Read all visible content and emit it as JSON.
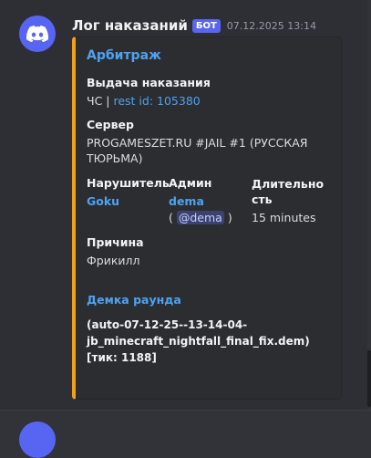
{
  "message": {
    "username": "Лог наказаний",
    "bot_tag": "БОТ",
    "timestamp": "07.12.2025 13:14",
    "avatar_icon": "discord-logo-icon"
  },
  "embed": {
    "accent_color": "#f0a020",
    "title": "Арбитраж",
    "issue_label": "Выдача наказания",
    "issue_prefix": "ЧС | ",
    "issue_link": "rest id: 105380",
    "server_label": "Сервер",
    "server_value": "PROGAMESZET.RU #JAIL #1 (РУССКАЯ ТЮРЬМА)",
    "violator_label": "Нарушитель",
    "violator_value": "Goku",
    "admin_label": "Админ",
    "admin_value": "dema",
    "admin_mention_open": "(",
    "admin_mention": "@dema",
    "admin_mention_close": ")",
    "duration_label": "Длительность",
    "duration_value": "15 minutes",
    "reason_label": "Причина",
    "reason_value": "Фрикилл",
    "demo_title": "Демка раунда",
    "demo_line1": "(auto-07-12-25--13-14-04-",
    "demo_line2": "jb_minecraft_nightfall_final_fix.dem)",
    "demo_line3": "[тик: 1188]"
  }
}
